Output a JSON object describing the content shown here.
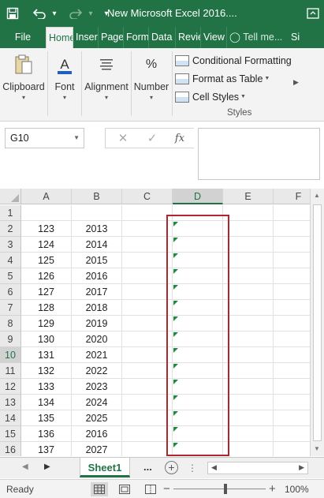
{
  "titlebar": {
    "title": "New Microsoft Excel 2016....",
    "save_icon": "save-icon",
    "undo_icon": "undo-icon",
    "redo_icon": "redo-icon"
  },
  "ribbon_tabs": [
    {
      "label": "File"
    },
    {
      "label": "Home"
    },
    {
      "label": "Insert"
    },
    {
      "label": "Page Layout"
    },
    {
      "label": "Formulas"
    },
    {
      "label": "Data"
    },
    {
      "label": "Review"
    },
    {
      "label": "View"
    },
    {
      "label": "Tell me..."
    },
    {
      "label": "Si"
    }
  ],
  "ribbon": {
    "clipboard": "Clipboard",
    "font": "Font",
    "alignment": "Alignment",
    "number": "Number",
    "number_symbol": "%",
    "conditional_formatting": "Conditional Formatting",
    "format_as_table": "Format as Table",
    "cell_styles": "Cell Styles",
    "styles_group": "Styles"
  },
  "formula_bar": {
    "name_box": "G10",
    "cancel": "✕",
    "enter": "✓",
    "fx": "fx",
    "value": ""
  },
  "grid": {
    "columns": [
      "A",
      "B",
      "C",
      "D",
      "E",
      "F"
    ],
    "selected_column": "D",
    "selected_row": "10",
    "rows": [
      {
        "num": "1",
        "a": "",
        "b": ""
      },
      {
        "num": "2",
        "a": "123",
        "b": "2013"
      },
      {
        "num": "3",
        "a": "124",
        "b": "2014"
      },
      {
        "num": "4",
        "a": "125",
        "b": "2015"
      },
      {
        "num": "5",
        "a": "126",
        "b": "2016"
      },
      {
        "num": "6",
        "a": "127",
        "b": "2017"
      },
      {
        "num": "7",
        "a": "128",
        "b": "2018"
      },
      {
        "num": "8",
        "a": "129",
        "b": "2019"
      },
      {
        "num": "9",
        "a": "130",
        "b": "2020"
      },
      {
        "num": "10",
        "a": "131",
        "b": "2021"
      },
      {
        "num": "11",
        "a": "132",
        "b": "2022"
      },
      {
        "num": "12",
        "a": "133",
        "b": "2023"
      },
      {
        "num": "13",
        "a": "134",
        "b": "2024"
      },
      {
        "num": "14",
        "a": "135",
        "b": "2025"
      },
      {
        "num": "15",
        "a": "136",
        "b": "2016"
      },
      {
        "num": "16",
        "a": "137",
        "b": "2027"
      }
    ]
  },
  "sheets": {
    "active": "Sheet1",
    "more": "...",
    "add": "+"
  },
  "status": {
    "ready": "Ready",
    "zoom": "100%",
    "minus": "−",
    "plus": "+"
  },
  "colors": {
    "brand": "#217346",
    "annotation": "#b0262c",
    "error_indicator": "#1e8a3d"
  }
}
